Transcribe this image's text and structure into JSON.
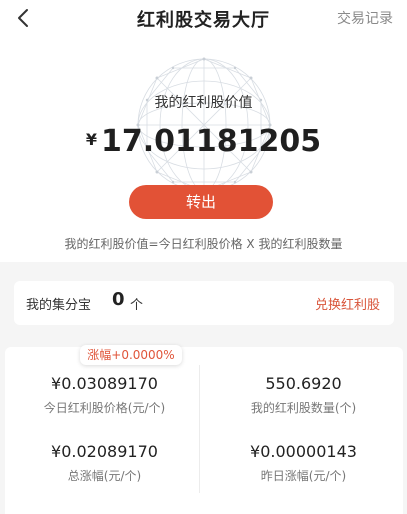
{
  "header": {
    "title": "红利股交易大厅",
    "records_label": "交易记录"
  },
  "hero": {
    "label": "我的红利股价值",
    "currency": "¥",
    "value": "17.01181205",
    "transfer_label": "转出",
    "formula": "我的红利股价值=今日红利股价格 X 我的红利股数量"
  },
  "points": {
    "label": "我的集分宝",
    "count": "0",
    "unit": "个",
    "exchange_label": "兑换红利股"
  },
  "stats": {
    "change_badge": "涨幅+0.0000%",
    "items": [
      {
        "value": "¥0.03089170",
        "label": "今日红利股价格(元/个)"
      },
      {
        "value": "550.6920",
        "label": "我的红利股数量(个)"
      },
      {
        "value": "¥0.02089170",
        "label": "总涨幅(元/个)"
      },
      {
        "value": "¥0.00000143",
        "label": "昨日涨幅(元/个)"
      }
    ]
  },
  "colors": {
    "accent": "#e25236",
    "link": "#d9553a"
  }
}
